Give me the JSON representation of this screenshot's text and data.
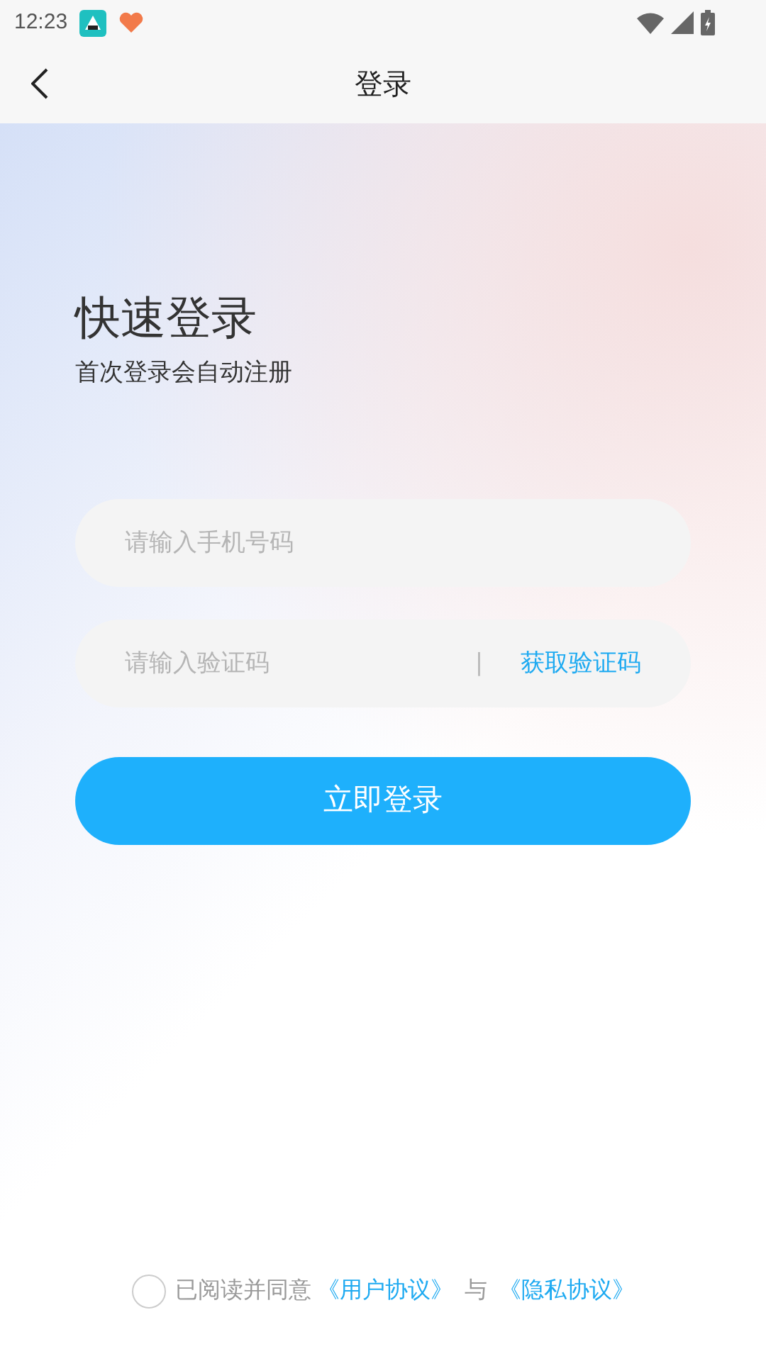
{
  "status_bar": {
    "time": "12:23"
  },
  "header": {
    "title": "登录"
  },
  "intro": {
    "title": "快速登录",
    "subtitle": "首次登录会自动注册"
  },
  "phone_field": {
    "placeholder": "请输入手机号码"
  },
  "code_field": {
    "placeholder": "请输入验证码",
    "separator": "|",
    "action": "获取验证码"
  },
  "login_button": {
    "label": "立即登录"
  },
  "agreement": {
    "checked": false,
    "text": "已阅读并同意",
    "link_1": "《用户协议》",
    "joiner": "与",
    "link_2": "《隐私协议》"
  }
}
